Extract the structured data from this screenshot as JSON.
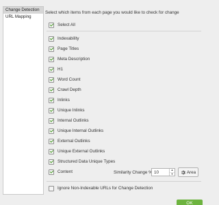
{
  "sidebar": {
    "items": [
      {
        "label": "Change Detection",
        "selected": true
      },
      {
        "label": "URL Mapping",
        "selected": false
      }
    ]
  },
  "panel": {
    "heading": "Select which items from each page you would like to check for change",
    "select_all": {
      "label": "Select All",
      "checked": true
    },
    "items": [
      {
        "label": "Indexability",
        "checked": true
      },
      {
        "label": "Page Titles",
        "checked": true
      },
      {
        "label": "Meta Description",
        "checked": true
      },
      {
        "label": "H1",
        "checked": true
      },
      {
        "label": "Word Count",
        "checked": true
      },
      {
        "label": "Crawl Depth",
        "checked": true
      },
      {
        "label": "Inlinks",
        "checked": true
      },
      {
        "label": "Unique Inlinks",
        "checked": true
      },
      {
        "label": "Internal Outlinks",
        "checked": true
      },
      {
        "label": "Unique Internal Outlinks",
        "checked": true
      },
      {
        "label": "External Outlinks",
        "checked": true
      },
      {
        "label": "Unique External Outlinks",
        "checked": true
      },
      {
        "label": "Structured Data Unique Types",
        "checked": true
      },
      {
        "label": "Content",
        "checked": true
      }
    ],
    "similarity": {
      "label": "Similarity Change %",
      "value": "10"
    },
    "area_button": {
      "label": "Area",
      "icon": "gear-icon"
    },
    "ignore_non_indexable": {
      "label": "Ignore Non-Indexable URLs for Change Detection",
      "checked": false
    }
  },
  "footer": {
    "ok_label": "OK"
  },
  "colors": {
    "accent": "#6db33f",
    "check": "#4a9a2a"
  }
}
